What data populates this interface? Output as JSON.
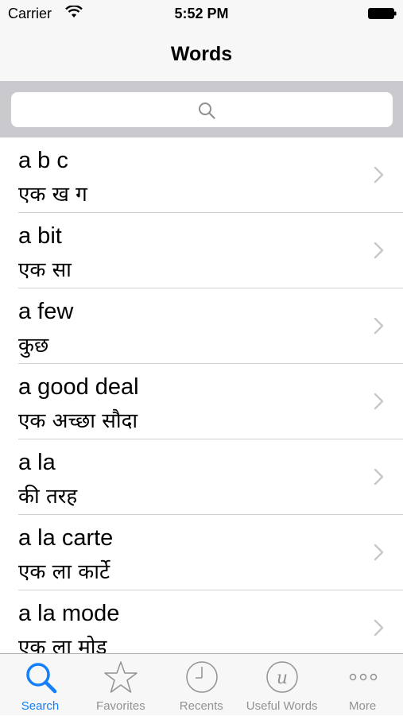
{
  "status_bar": {
    "carrier": "Carrier",
    "time": "5:52 PM"
  },
  "nav": {
    "title": "Words"
  },
  "search": {
    "placeholder": ""
  },
  "words": [
    {
      "en": "a b c",
      "hi": "एक ख ग"
    },
    {
      "en": "a bit",
      "hi": "एक सा"
    },
    {
      "en": "a few",
      "hi": "कुछ"
    },
    {
      "en": "a good deal",
      "hi": "एक अच्छा सौदा"
    },
    {
      "en": "a la",
      "hi": "की तरह"
    },
    {
      "en": "a la carte",
      "hi": "एक ला कार्टे"
    },
    {
      "en": "a la mode",
      "hi": "एक ला मोड"
    }
  ],
  "tabs": [
    {
      "label": "Search",
      "icon": "search-icon",
      "active": true
    },
    {
      "label": "Favorites",
      "icon": "star-icon",
      "active": false
    },
    {
      "label": "Recents",
      "icon": "clock-icon",
      "active": false
    },
    {
      "label": "Useful Words",
      "icon": "useful-words-icon",
      "active": false
    },
    {
      "label": "More",
      "icon": "more-icon",
      "active": false
    }
  ],
  "colors": {
    "accent": "#147efb",
    "inactive": "#929292",
    "search_bar_bg": "#c9c9ce"
  }
}
